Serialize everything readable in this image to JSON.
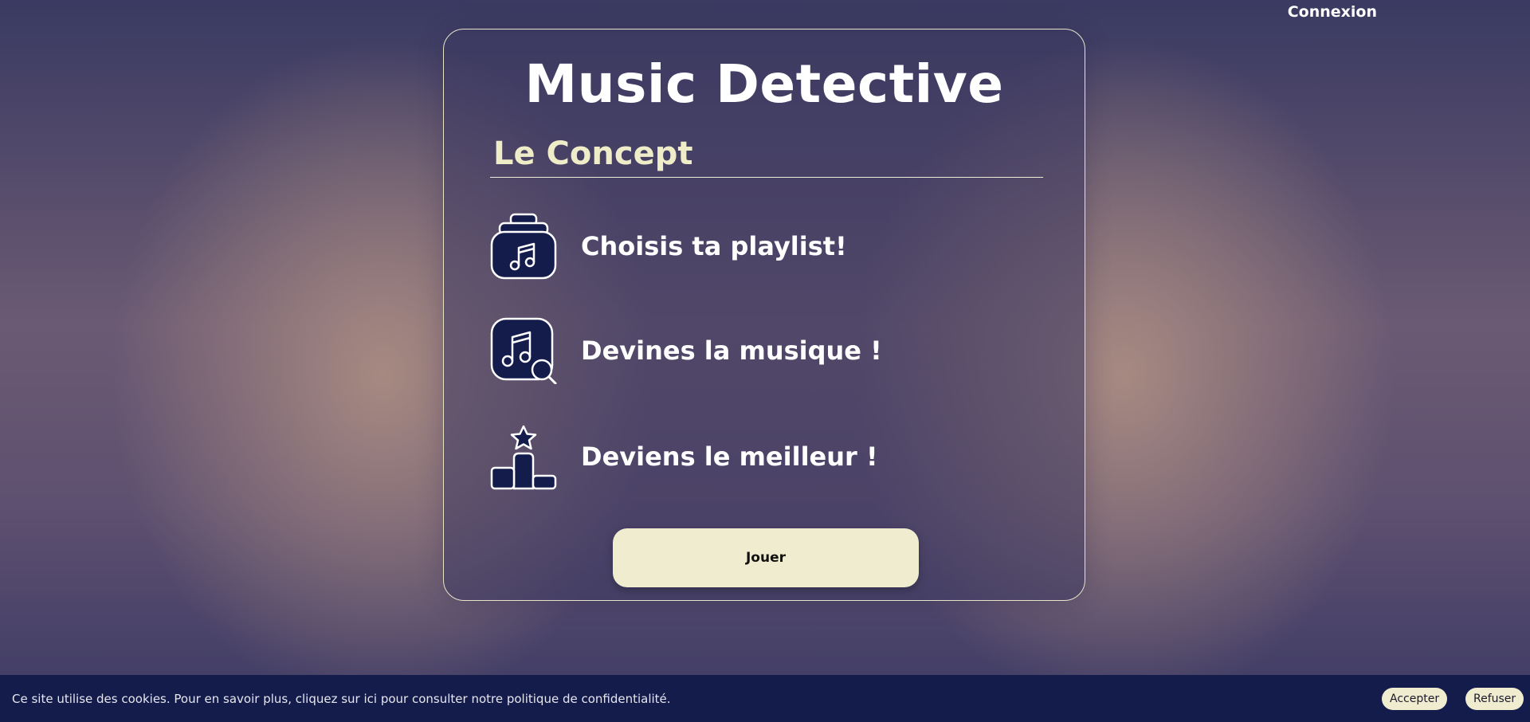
{
  "header": {
    "login_label": "Connexion"
  },
  "card": {
    "title": "Music Detective",
    "section_title": "Le Concept",
    "steps": [
      {
        "icon": "music-bag-icon",
        "label": "Choisis ta playlist!"
      },
      {
        "icon": "music-search-icon",
        "label": "Devines la musique !"
      },
      {
        "icon": "podium-star-icon",
        "label": "Deviens le meilleur !"
      }
    ],
    "play_label": "Jouer"
  },
  "cookie_bar": {
    "message": "Ce site utilise des cookies. Pour en savoir plus, cliquez sur ici pour consulter notre politique de confidentialité.",
    "accept_label": "Accepter",
    "refuse_label": "Refuser"
  },
  "colors": {
    "accent_cream": "#efecd0",
    "icon_navy": "#141c4c",
    "cookie_bar_bg": "#141c4c"
  }
}
